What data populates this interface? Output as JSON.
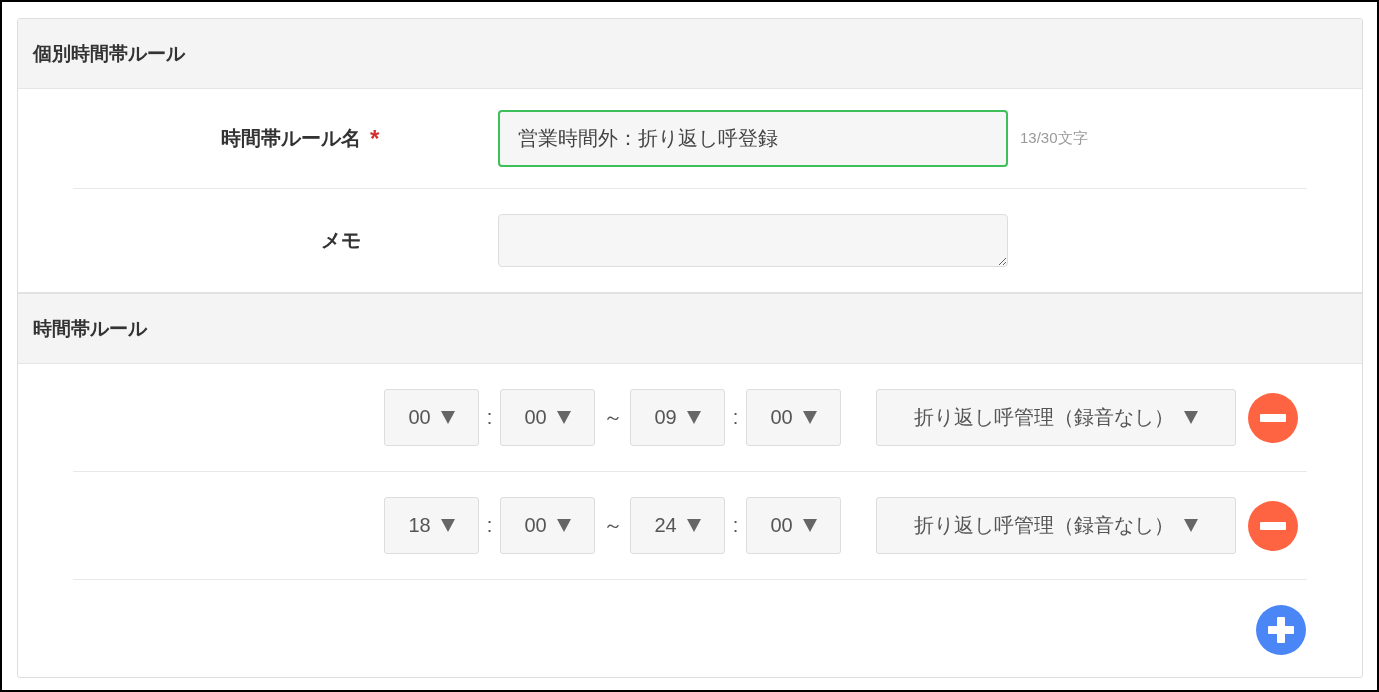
{
  "sections": [
    {
      "title": "個別時間帯ルール",
      "kind": "form"
    },
    {
      "title": "時間帯ルール",
      "kind": "rules"
    }
  ],
  "name_field": {
    "label": "時間帯ルール名",
    "required_mark": "*",
    "value": "営業時間外：折り返し呼登録",
    "focused": true,
    "counter": "13/30文字"
  },
  "memo_field": {
    "label": "メモ"
  },
  "rules": [
    {
      "start_hour": "00",
      "colon_1": ":",
      "start_minute": "00",
      "tilde": "～",
      "end_hour": "09",
      "colon_2": ":",
      "end_minute": "00",
      "action": "折り返し呼管理（録音なし）"
    },
    {
      "start_hour": "18",
      "colon_1": ":",
      "start_minute": "00",
      "tilde": "～",
      "end_hour": "24",
      "colon_2": ":",
      "end_minute": "00",
      "action": "折り返し呼管理（録音なし）"
    }
  ]
}
